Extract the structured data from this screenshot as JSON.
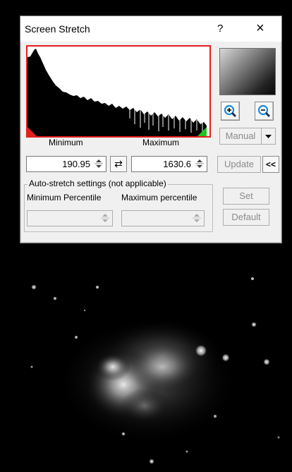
{
  "window": {
    "title": "Screen Stretch",
    "help_label": "?",
    "close_label": "×"
  },
  "stretch": {
    "minimum_label": "Minimum",
    "maximum_label": "Maximum",
    "minimum_value": "190.95",
    "maximum_value": "1630.6",
    "swap_label": "⇄"
  },
  "controls": {
    "mode_value": "Manual",
    "update_label": "Update",
    "collapse_label": "<<",
    "zoom_in_icon": "zoom-in-magnifier",
    "zoom_out_icon": "zoom-out-magnifier"
  },
  "auto_stretch": {
    "group_label": "Auto-stretch settings (not applicable)",
    "min_percentile_label": "Minimum Percentile",
    "max_percentile_label": "Maximum percentile",
    "min_percentile_value": "",
    "max_percentile_value": "",
    "set_label": "Set",
    "default_label": "Default"
  },
  "colors": {
    "histogram_border": "#e1201c",
    "min_marker": "#e1201c",
    "max_marker": "#22c322",
    "dialog_bg": "#f0f0f0"
  }
}
